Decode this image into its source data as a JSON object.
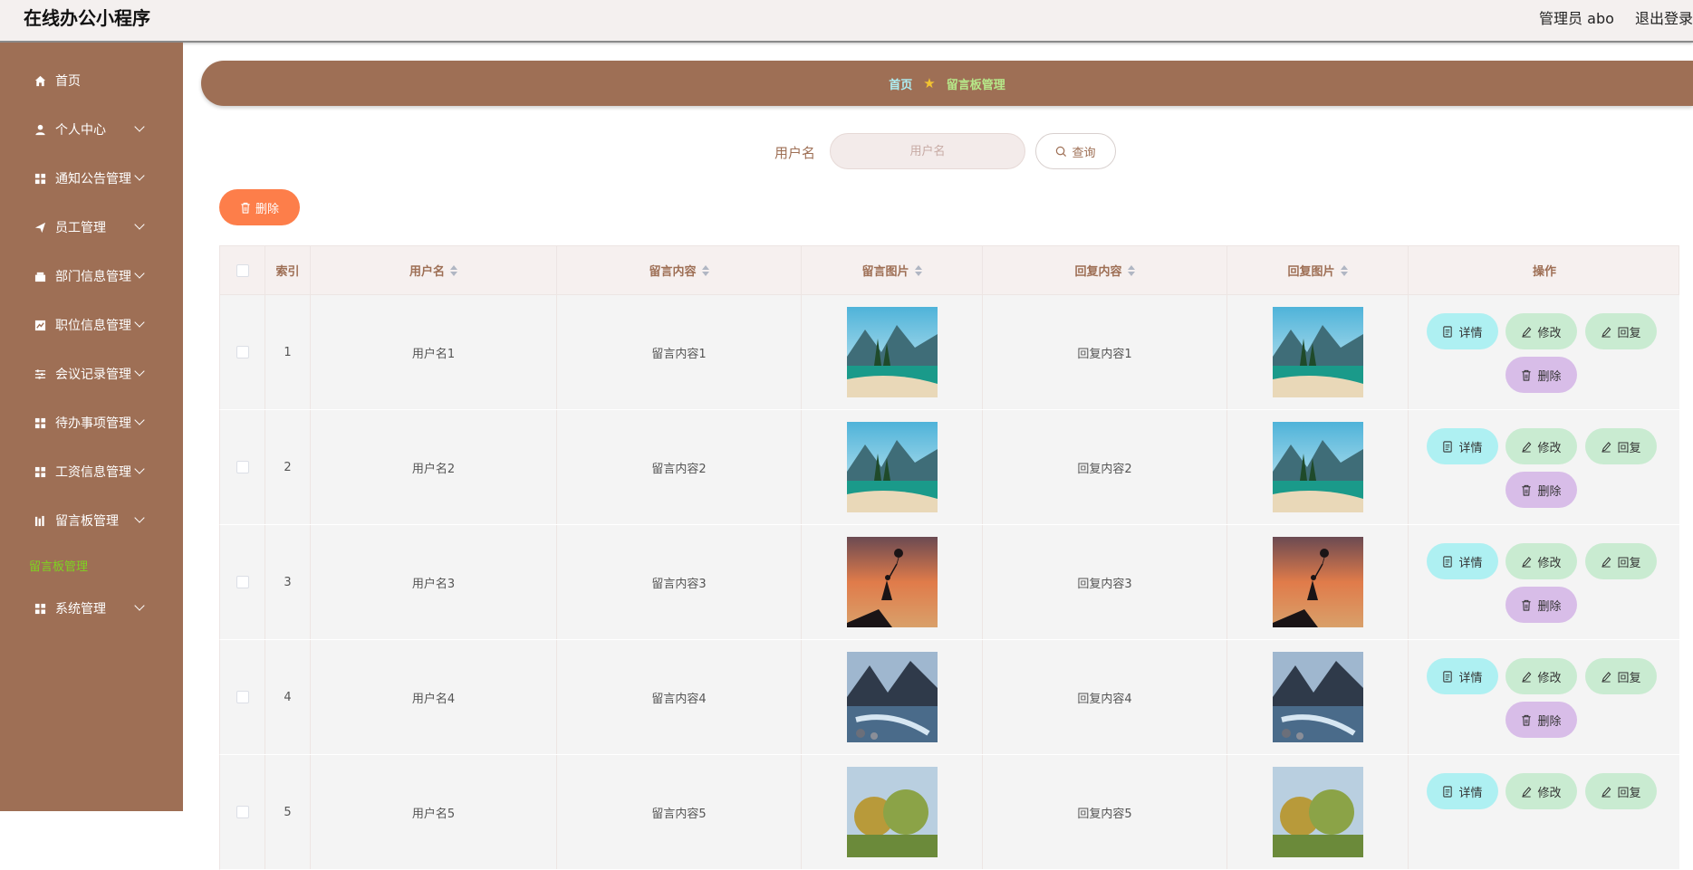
{
  "app": {
    "title": "在线办公小程序"
  },
  "header": {
    "user": "管理员 abo",
    "logout": "退出登录"
  },
  "sidebar": {
    "items": [
      {
        "label": "首页",
        "icon": "home-icon"
      },
      {
        "label": "个人中心",
        "icon": "user-icon"
      },
      {
        "label": "通知公告管理",
        "icon": "grid-icon"
      },
      {
        "label": "员工管理",
        "icon": "send-icon"
      },
      {
        "label": "部门信息管理",
        "icon": "building-icon"
      },
      {
        "label": "职位信息管理",
        "icon": "chart-icon"
      },
      {
        "label": "会议记录管理",
        "icon": "sliders-icon"
      },
      {
        "label": "待办事项管理",
        "icon": "grid-icon"
      },
      {
        "label": "工资信息管理",
        "icon": "grid-icon"
      },
      {
        "label": "留言板管理",
        "icon": "bars-icon"
      },
      {
        "label": "系统管理",
        "icon": "grid-icon"
      }
    ],
    "active_sub": "留言板管理"
  },
  "breadcrumb": {
    "home": "首页",
    "current": "留言板管理"
  },
  "search": {
    "label": "用户名",
    "placeholder": "用户名",
    "button": "查询"
  },
  "toolbar": {
    "delete": "删除"
  },
  "table": {
    "headers": {
      "index": "索引",
      "username": "用户名",
      "content": "留言内容",
      "image": "留言图片",
      "reply": "回复内容",
      "reply_image": "回复图片",
      "actions": "操作"
    },
    "rows": [
      {
        "index": "1",
        "username": "用户名1",
        "content": "留言内容1",
        "reply": "回复内容1",
        "img": "lake"
      },
      {
        "index": "2",
        "username": "用户名2",
        "content": "留言内容2",
        "reply": "回复内容2",
        "img": "lake"
      },
      {
        "index": "3",
        "username": "用户名3",
        "content": "留言内容3",
        "reply": "回复内容3",
        "img": "girl"
      },
      {
        "index": "4",
        "username": "用户名4",
        "content": "留言内容4",
        "reply": "回复内容4",
        "img": "river"
      },
      {
        "index": "5",
        "username": "用户名5",
        "content": "留言内容5",
        "reply": "回复内容5",
        "img": "trees"
      }
    ],
    "actions": {
      "detail": "详情",
      "edit": "修改",
      "reply": "回复",
      "delete": "删除"
    }
  },
  "colors": {
    "brand": "#9e6f55",
    "accent_orange": "#fd7e4a",
    "submenu_active": "#7ed321"
  }
}
